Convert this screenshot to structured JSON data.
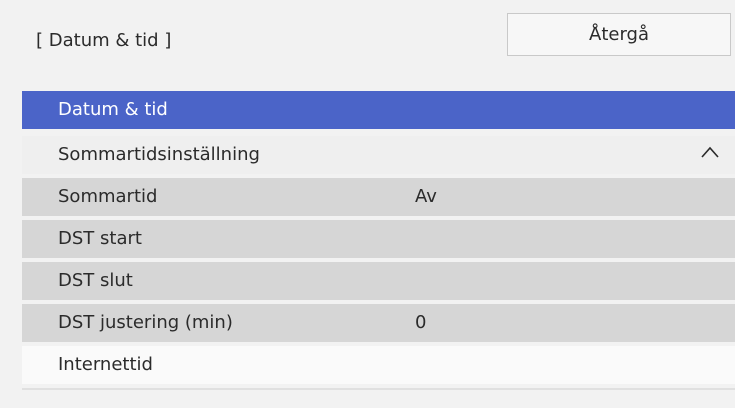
{
  "header": {
    "title": "[ Datum & tid ]",
    "back_label": "Återgå"
  },
  "menu": {
    "items": [
      {
        "label": "Datum & tid",
        "state": "selected"
      },
      {
        "label": "Sommartidsinställning",
        "state": "expanded",
        "icon": "chevron-up-icon"
      },
      {
        "label": "Sommartid",
        "value": "Av"
      },
      {
        "label": "DST start"
      },
      {
        "label": "DST slut"
      },
      {
        "label": "DST justering (min)",
        "value": "0"
      },
      {
        "label": "Internettid"
      }
    ]
  },
  "colors": {
    "selected_bg": "#4b64c8",
    "submenu_bg": "#d6d6d6",
    "panel_bg": "#f2f2f2"
  }
}
